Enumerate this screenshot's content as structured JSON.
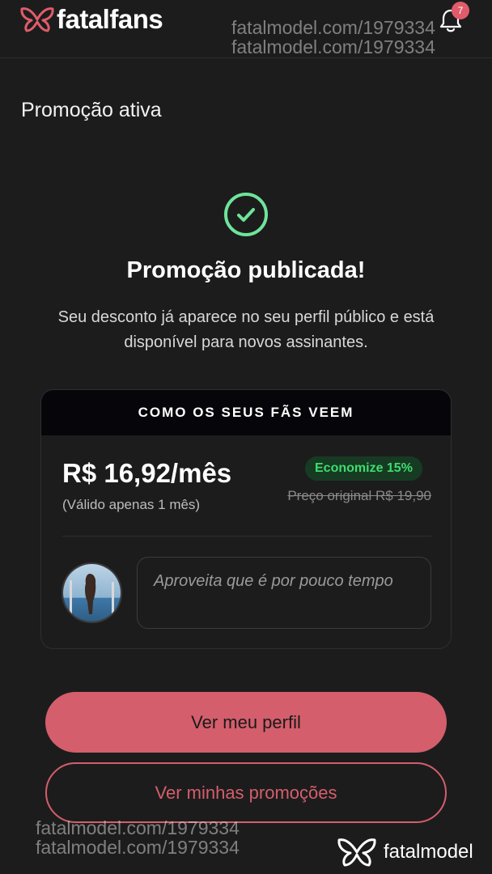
{
  "header": {
    "brand": "fatalfans",
    "notifications_count": "7"
  },
  "watermarks": {
    "top_1": "fatalmodel.com/1979334",
    "top_2": "fatalmodel.com/1979334",
    "bottom_1": "fatalmodel.com/1979334",
    "bottom_2": "fatalmodel.com/1979334",
    "logo": "fatalmodel"
  },
  "page": {
    "section_title": "Promoção ativa",
    "headline": "Promoção publicada!",
    "subtext": "Seu desconto já aparece no seu perfil público e está disponível para novos assinantes."
  },
  "preview_card": {
    "heading": "COMO OS SEUS FÃS VEEM",
    "price": "R$ 16,92/mês",
    "validity": "(Válido apenas 1 mês)",
    "savings_badge": "Economize 15%",
    "original_price": "Preço original R$ 19,90",
    "message": "Aproveita que é por pouco tempo"
  },
  "actions": {
    "primary_label": "Ver meu perfil",
    "secondary_label": "Ver minhas promoções"
  },
  "colors": {
    "background": "#1c1c1d",
    "accent": "#d45e6b",
    "success": "#3ddc6e",
    "check_ring": "#6fe39a"
  },
  "icons": {
    "brand": "butterfly-logo-icon",
    "notifications": "bell-icon",
    "success": "check-circle-icon"
  }
}
